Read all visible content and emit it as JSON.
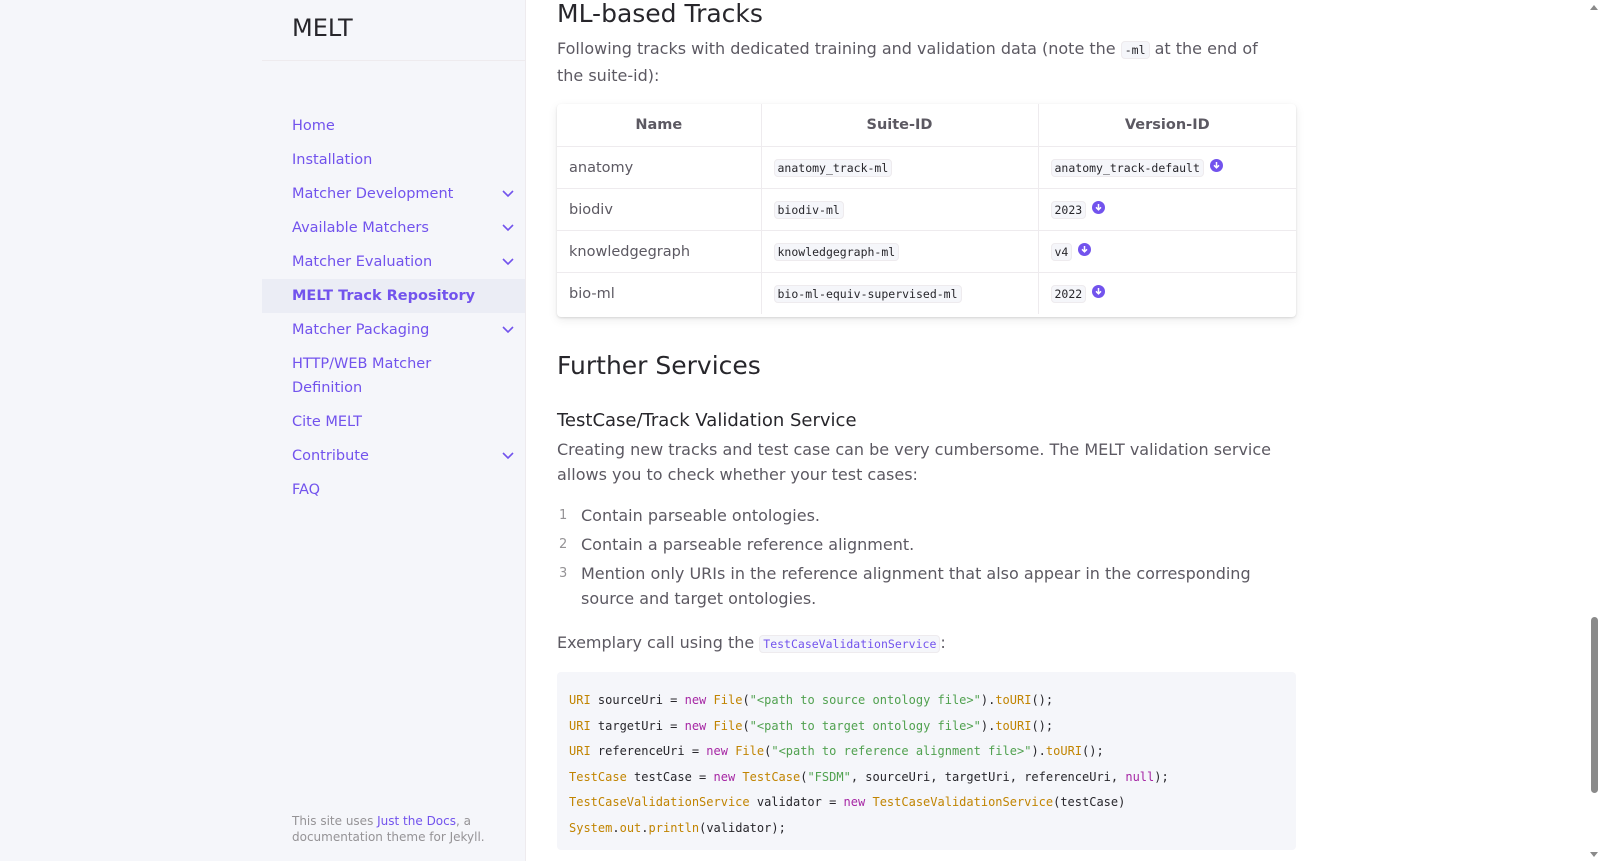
{
  "site": {
    "title": "MELT"
  },
  "nav": {
    "items": [
      {
        "label": "Home",
        "expandable": false,
        "active": false
      },
      {
        "label": "Installation",
        "expandable": false,
        "active": false
      },
      {
        "label": "Matcher Development",
        "expandable": true,
        "active": false
      },
      {
        "label": "Available Matchers",
        "expandable": true,
        "active": false
      },
      {
        "label": "Matcher Evaluation",
        "expandable": true,
        "active": false
      },
      {
        "label": "MELT Track Repository",
        "expandable": false,
        "active": true
      },
      {
        "label": "Matcher Packaging",
        "expandable": true,
        "active": false
      },
      {
        "label": "HTTP/WEB Matcher Definition",
        "expandable": false,
        "active": false
      },
      {
        "label": "Cite MELT",
        "expandable": false,
        "active": false
      },
      {
        "label": "Contribute",
        "expandable": true,
        "active": false
      },
      {
        "label": "FAQ",
        "expandable": false,
        "active": false
      }
    ]
  },
  "footer": {
    "prefix": "This site uses ",
    "link": "Just the Docs",
    "suffix": ", a documentation theme for Jekyll."
  },
  "ml_tracks": {
    "heading": "ML-based Tracks",
    "intro_before": "Following tracks with dedicated training and validation data (note the ",
    "intro_code": "-ml",
    "intro_after": " at the end of the suite-id):",
    "columns": [
      "Name",
      "Suite-ID",
      "Version-ID"
    ],
    "rows": [
      {
        "name": "anatomy",
        "suite": "anatomy_track-ml",
        "version": "anatomy_track-default"
      },
      {
        "name": "biodiv",
        "suite": "biodiv-ml",
        "version": "2023"
      },
      {
        "name": "knowledgegraph",
        "suite": "knowledgegraph-ml",
        "version": "v4"
      },
      {
        "name": "bio-ml",
        "suite": "bio-ml-equiv-supervised-ml",
        "version": "2022"
      }
    ]
  },
  "further": {
    "heading": "Further Services",
    "subheading": "TestCase/Track Validation Service",
    "intro": "Creating new tracks and test case can be very cumbersome. The MELT validation service allows you to check whether your test cases:",
    "list": [
      {
        "num": "1",
        "text": "Contain parseable ontologies."
      },
      {
        "num": "2",
        "text": "Contain a parseable reference alignment."
      },
      {
        "num": "3",
        "text": "Mention only URIs in the reference alignment that also appear in the corresponding source and target ontologies."
      }
    ],
    "example_before": "Exemplary call using the ",
    "example_code": "TestCaseValidationService",
    "example_after": ":"
  },
  "code_lines": [
    "URI sourceUri = new File(\"<path to source ontology file>\").toURI();",
    "URI targetUri = new File(\"<path to target ontology file>\").toURI();",
    "URI referenceUri = new File(\"<path to reference alignment file>\").toURI();",
    "TestCase testCase = new TestCase(\"FSDM\", sourceUri, targetUri, referenceUri, null);",
    "TestCaseValidationService validator = new TestCaseValidationService(testCase)",
    "System.out.println(validator);"
  ],
  "icons": {
    "expander": "chevron-down-icon",
    "download": "download-circle-icon"
  },
  "colors": {
    "accent": "#7253ed",
    "sidebar_bg": "#f5f6fa",
    "text": "#5c5962"
  }
}
